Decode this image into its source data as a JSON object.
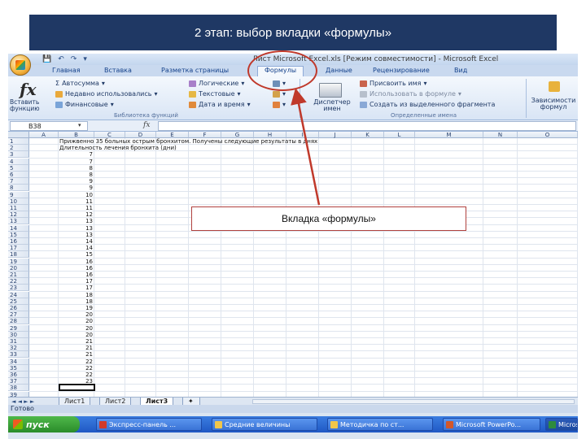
{
  "slide": {
    "title": "2 этап: выбор вкладки «формулы»",
    "callout": "Вкладка «формулы»"
  },
  "excel": {
    "window_title": "Лист Microsoft Excel.xls  [Режим совместимости] - Microsoft Excel",
    "qat": [
      "💾",
      "↶",
      "↷",
      "▾"
    ],
    "tabs": [
      "Главная",
      "Вставка",
      "Разметка страницы",
      "Формулы",
      "Данные",
      "Рецензирование",
      "Вид"
    ],
    "active_tab": "Формулы",
    "ribbon": {
      "insert_function": "Вставить функцию",
      "autosum": "Автосумма",
      "recent": "Недавно использовались",
      "financial": "Финансовые",
      "logical": "Логические",
      "text": "Текстовые",
      "datetime": "Дата и время",
      "library_label": "Библиотека функций",
      "name_manager": "Диспетчер имен",
      "assign_name": "Присвоить имя",
      "use_in_formula": "Использовать в формуле",
      "create_from_selection": "Создать из выделенного фрагмента",
      "defined_names_label": "Определенные имена",
      "dependencies": "Зависимости формул"
    },
    "name_box": "B38",
    "fx_label": "fx",
    "columns": [
      "A",
      "B",
      "C",
      "D",
      "E",
      "F",
      "G",
      "H",
      "I",
      "J",
      "K",
      "L",
      "M",
      "N",
      "O"
    ],
    "rows": [
      "1",
      "2",
      "3",
      "4",
      "5",
      "6",
      "7",
      "8",
      "9",
      "10",
      "11",
      "12",
      "13",
      "14",
      "15",
      "16",
      "17",
      "18",
      "19",
      "20",
      "21",
      "22",
      "23",
      "24",
      "25",
      "26",
      "27",
      "28",
      "29",
      "30",
      "31",
      "32",
      "33",
      "34",
      "35",
      "36",
      "37",
      "38",
      "39"
    ],
    "row1_text": "Прижвенно 35 больных острым бронхитом. Получены следующие результаты в днях",
    "row2_text": "Длительность лечения бронхита (дни)",
    "values": [
      "7",
      "7",
      "8",
      "8",
      "9",
      "9",
      "10",
      "11",
      "11",
      "12",
      "13",
      "13",
      "13",
      "14",
      "14",
      "15",
      "16",
      "16",
      "16",
      "17",
      "17",
      "18",
      "18",
      "19",
      "20",
      "20",
      "20",
      "20",
      "21",
      "21",
      "21",
      "22",
      "22",
      "22",
      "23"
    ],
    "sheet_tabs": [
      "Лист1",
      "Лист2",
      "Лист3"
    ],
    "active_sheet": "Лист3",
    "nav": "◄ ◄ ► ►",
    "status": "Готово"
  },
  "taskbar": {
    "start": "пуск",
    "buttons": [
      "Экспресс-панель ...",
      "Средние величины",
      "Методичка по ст...",
      "Microsoft PowerPo...",
      "Microsoft Excel - ..."
    ]
  },
  "colors": {
    "title_bg": "#1f3864",
    "annotation": "#c0392b",
    "taskbar": "#2a62cc"
  }
}
